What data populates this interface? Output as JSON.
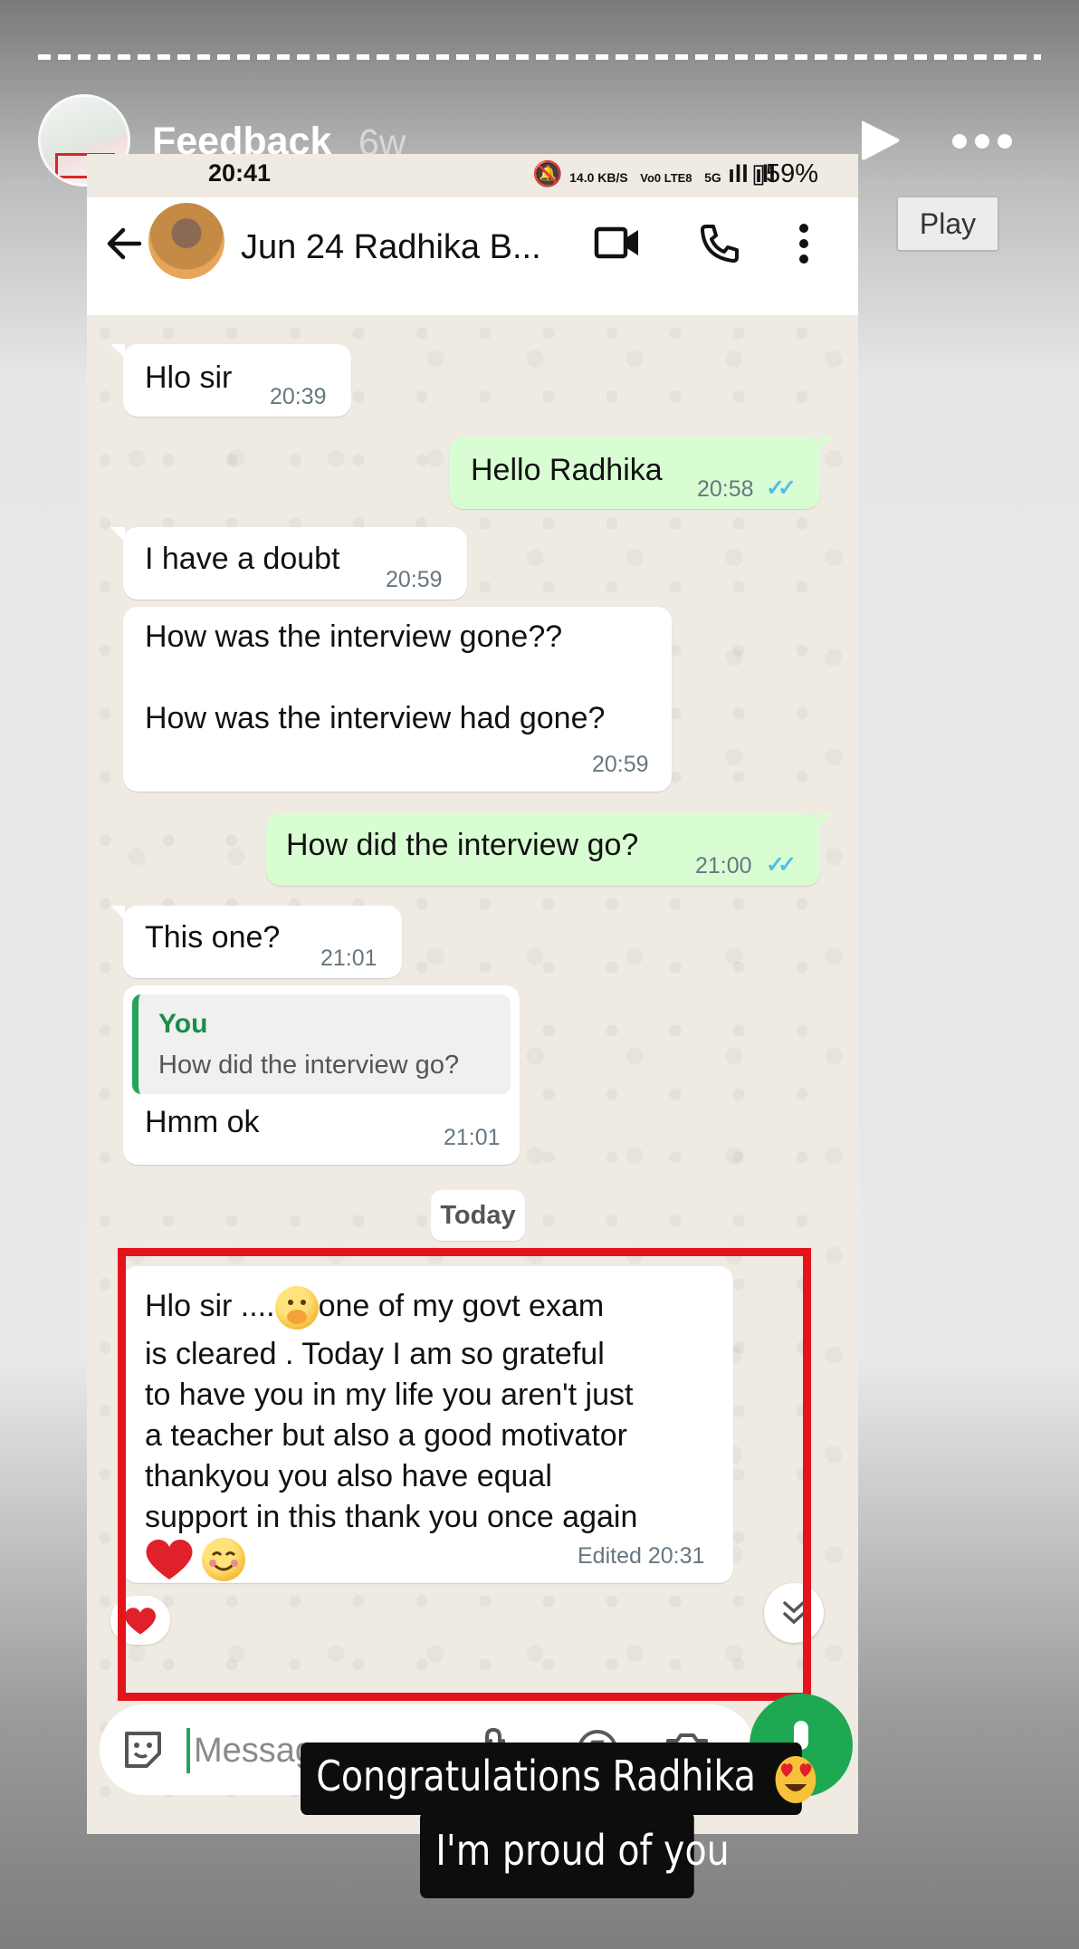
{
  "story": {
    "title": "Feedback",
    "age": "6w",
    "tooltip": "Play",
    "icons": [
      "play-icon",
      "more-icon"
    ]
  },
  "phone_status": {
    "time": "20:41",
    "network": "14.0 KB/S",
    "volte": "Vo0 LTE8",
    "signal": "5G",
    "battery": "59%"
  },
  "chat_header": {
    "contact_name": "Jun 24 Radhika B..."
  },
  "messages": [
    {
      "dir": "in",
      "text": "Hlo sir",
      "time": "20:39"
    },
    {
      "dir": "out",
      "text": "Hello Radhika",
      "time": "20:58",
      "read": true
    },
    {
      "dir": "in",
      "text": "I have a doubt",
      "time": "20:59"
    },
    {
      "dir": "in",
      "lines": [
        "How was the interview gone??",
        "How was the interview had gone?"
      ],
      "time": "20:59"
    },
    {
      "dir": "out",
      "text": "How did the interview go?",
      "time": "21:00",
      "read": true
    },
    {
      "dir": "in",
      "text": "This one?",
      "time": "21:01"
    },
    {
      "dir": "in",
      "quote_author": "You",
      "quote_text": "How did the interview go?",
      "text": "Hmm ok",
      "time": "21:01"
    }
  ],
  "date_separator": "Today",
  "highlighted_message": {
    "line1_start": "Hlo sir ....",
    "line1_end": "one of my govt exam",
    "lines": [
      "is cleared . Today I am so grateful",
      "to have you in my life you aren't just",
      "a teacher but also a good motivator",
      "thankyou you also have equal",
      "support in this thank you once again"
    ],
    "time": "Edited 20:31",
    "reaction": "heart"
  },
  "composer": {
    "placeholder": "Message"
  },
  "caption": {
    "line1": "Congratulations Radhika",
    "line2": "I'm proud of you"
  },
  "colors": {
    "highlight_border": "#e3141b",
    "outgoing_bubble": "#d9fdd3",
    "read_ticks": "#53bdeb",
    "mic_button": "#1da851"
  }
}
